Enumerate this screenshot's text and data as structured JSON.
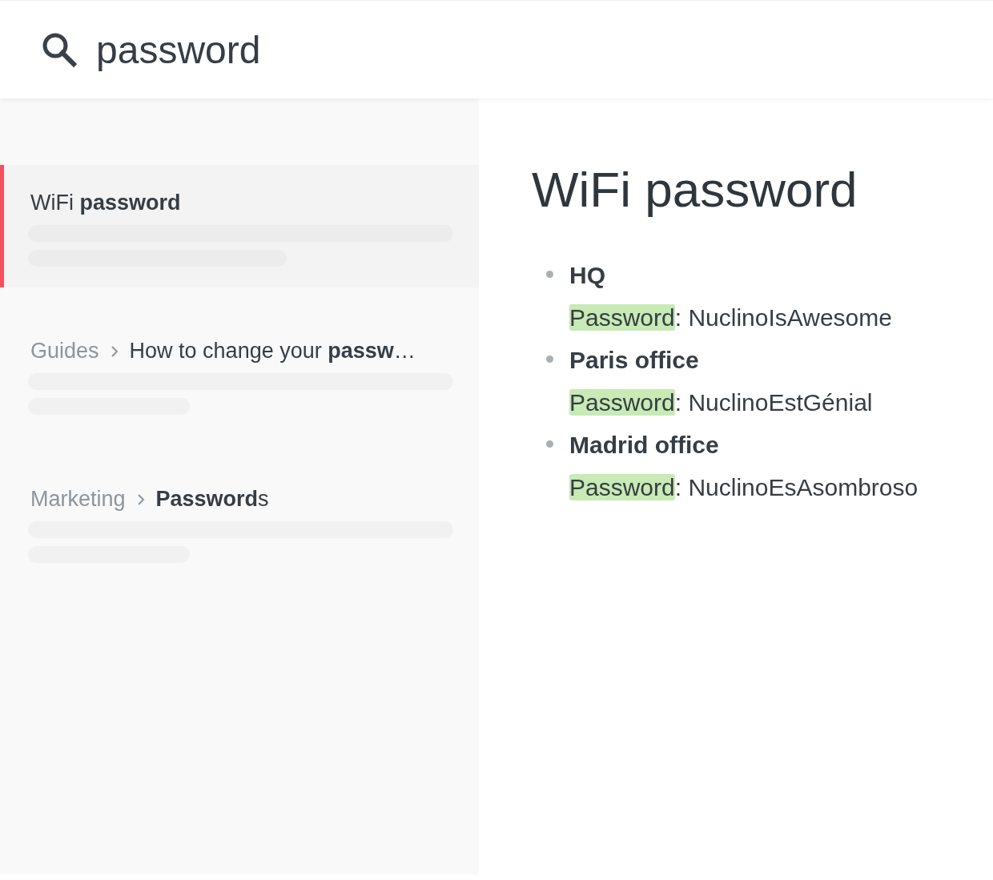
{
  "search": {
    "value": "password"
  },
  "results": [
    {
      "title": "WiFi **password**",
      "selected": true
    },
    {
      "path": "Guides",
      "title": "How to change your **passw**…",
      "selected": false
    },
    {
      "path": "Marketing",
      "title": "**Password**s",
      "selected": false
    }
  ],
  "document": {
    "title": "WiFi password",
    "items": [
      {
        "heading": "HQ",
        "highlight": "Password",
        "rest": ": NuclinoIsAwesome"
      },
      {
        "heading": "Paris office",
        "highlight": "Password",
        "rest": ": NuclinoEstGénial"
      },
      {
        "heading": "Madrid office",
        "highlight": "Password",
        "rest": ": NuclinoEsAsombroso"
      }
    ]
  }
}
